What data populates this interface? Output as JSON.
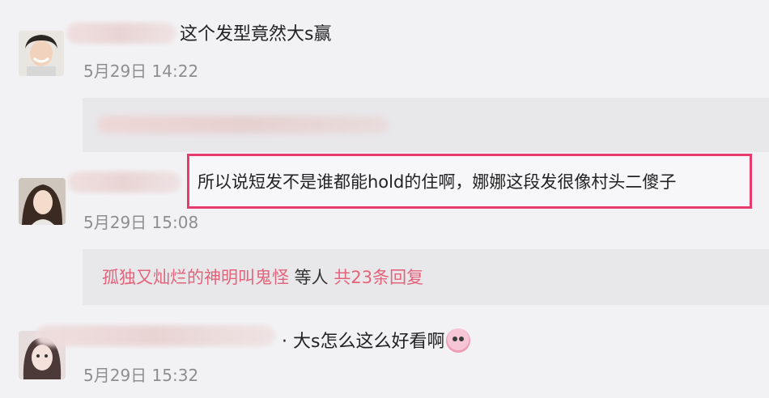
{
  "comments": [
    {
      "text": "这个发型竟然大s赢",
      "time": "5月29日 14:22"
    },
    {
      "text": "所以说短发不是谁都能hold的住啊，娜娜这段发很像村头二傻子",
      "time": "5月29日 15:08",
      "replies": {
        "user": "孤独又灿烂的神明叫鬼怪",
        "middle": " 等人 ",
        "count": "共23条回复"
      }
    },
    {
      "text": "大s怎么这么好看啊",
      "time": "5月29日 15:32"
    }
  ],
  "highlight_color": "#e83c6f",
  "link_color": "#e4637a"
}
